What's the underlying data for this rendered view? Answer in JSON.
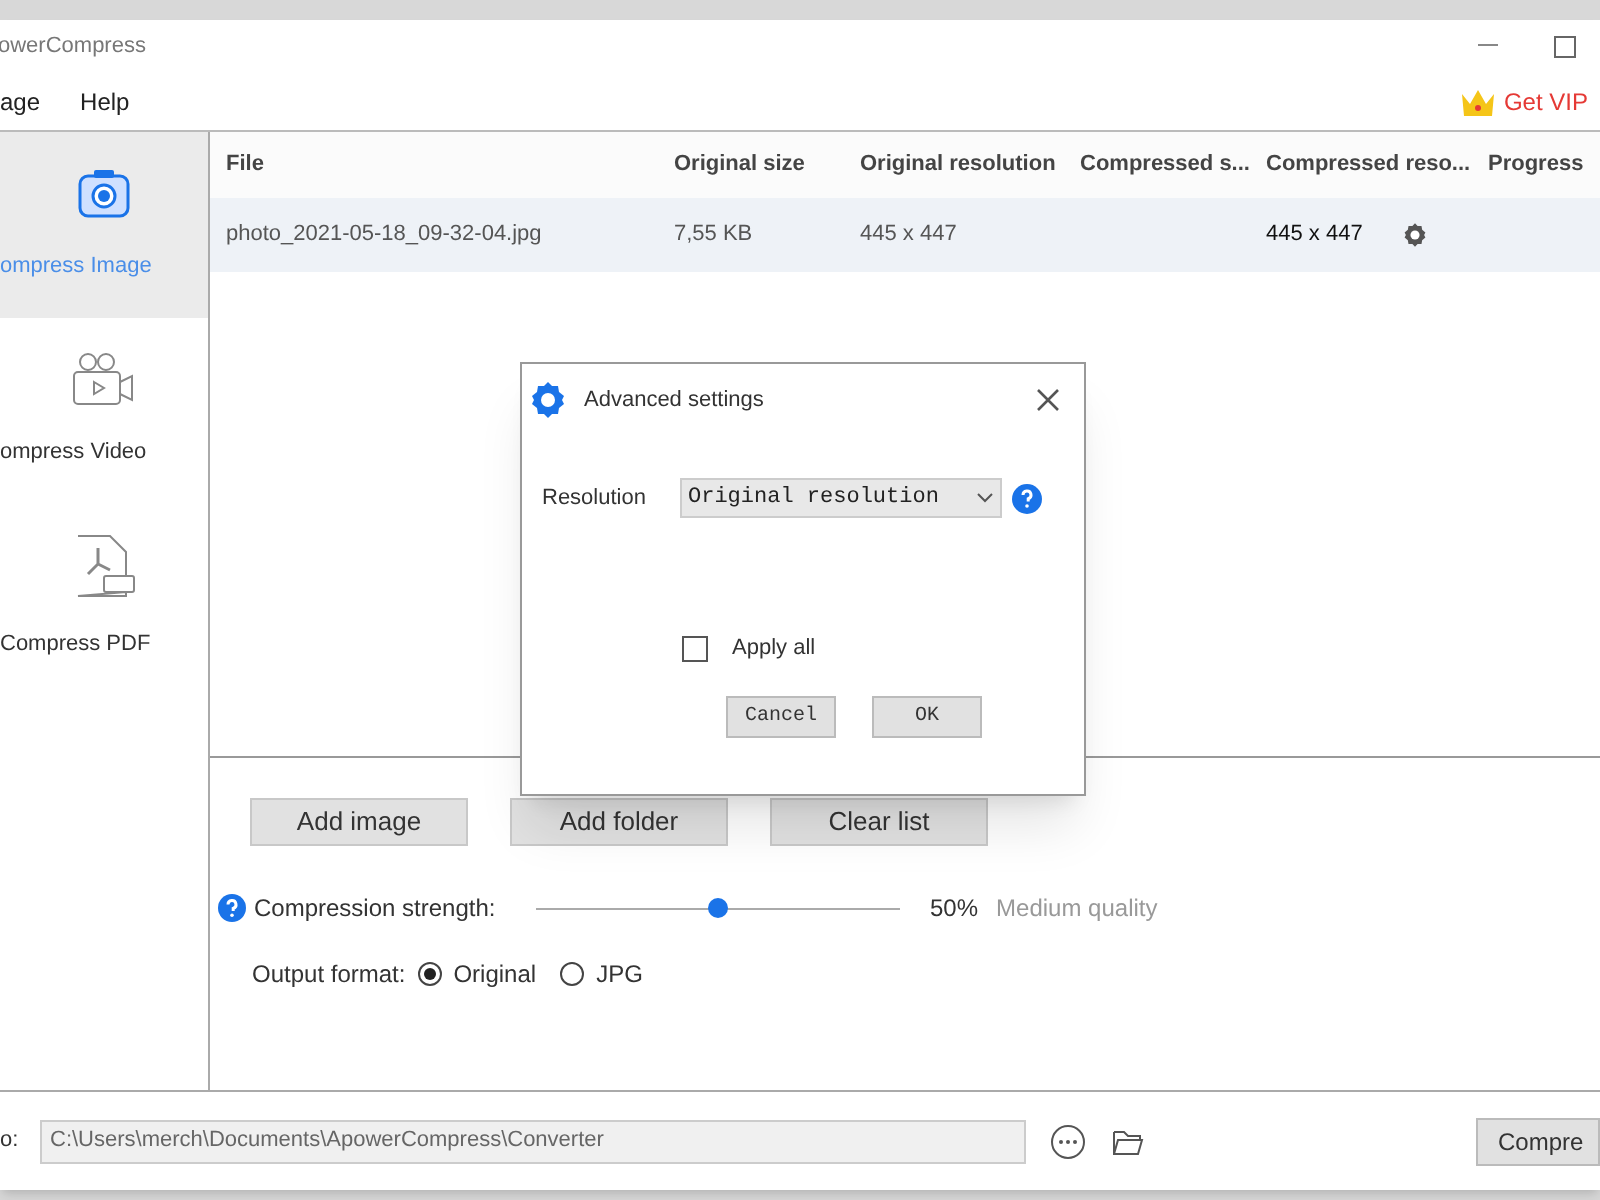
{
  "window": {
    "title": "owerCompress"
  },
  "menu": [
    "age",
    "Help"
  ],
  "vip": {
    "label": "Get VIP"
  },
  "sidebar": {
    "items": [
      {
        "label": "ompress Image",
        "kind": "image",
        "selected": true
      },
      {
        "label": "ompress Video",
        "kind": "video",
        "selected": false
      },
      {
        "label": "Compress PDF",
        "kind": "pdf",
        "selected": false
      }
    ]
  },
  "table": {
    "columns": [
      "File",
      "Original size",
      "Original resolution",
      "Compressed s...",
      "Compressed reso...",
      "Progress"
    ],
    "rows": [
      {
        "selected": true,
        "cells": [
          "photo_2021-05-18_09-32-04.jpg",
          "7,55 KB",
          "445 x 447",
          "",
          "445 x 447",
          ""
        ]
      }
    ]
  },
  "actions": [
    "Add image",
    "Add folder",
    "Clear list"
  ],
  "compression": {
    "label": "Compression strength:",
    "level": 0.5,
    "percent": "50%",
    "quality": "Medium quality"
  },
  "output_format": {
    "label": "Output format:",
    "options": [
      {
        "label": "Original",
        "selected": true
      },
      {
        "label": "JPG",
        "selected": false
      }
    ]
  },
  "output_path": {
    "label": "o:",
    "value": "C:\\Users\\merch\\Documents\\ApowerCompress\\Converter"
  },
  "compress_button": "Compre",
  "dialog": {
    "title": "Advanced settings",
    "resolution_label": "Resolution",
    "resolution_value": "Original resolution",
    "apply_all": {
      "label": "Apply all",
      "checked": false
    },
    "buttons": [
      "Cancel",
      "OK"
    ]
  }
}
